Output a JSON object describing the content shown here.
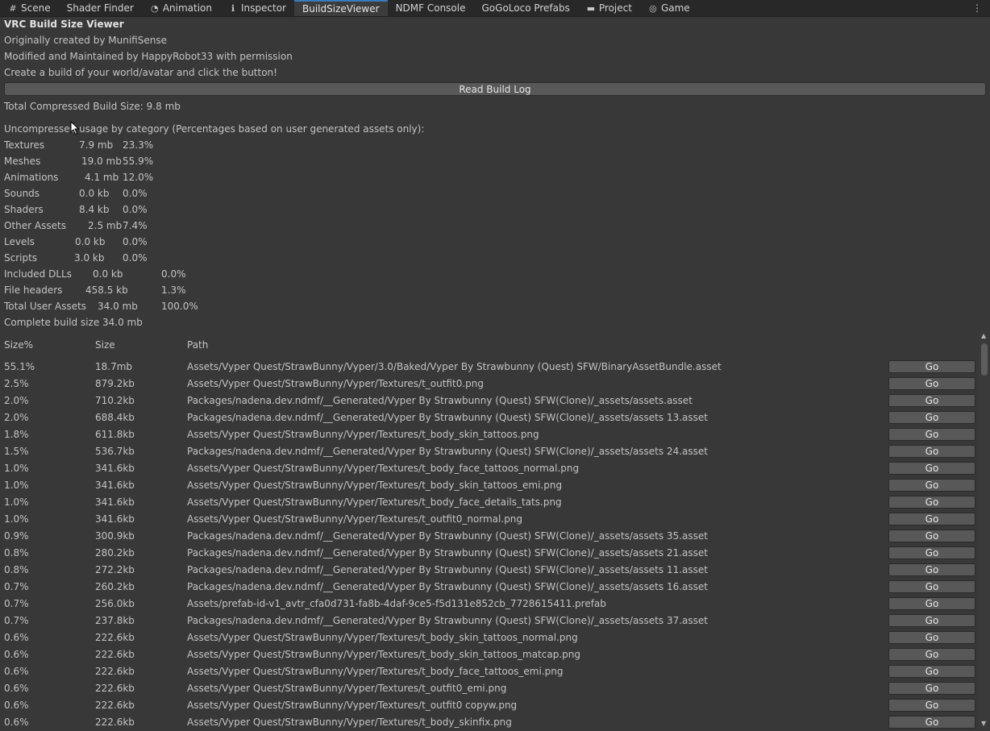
{
  "tabs": [
    {
      "icon": "#",
      "label": "Scene",
      "name": "tab-scene"
    },
    {
      "icon": "",
      "label": "Shader Finder",
      "name": "tab-shader-finder"
    },
    {
      "icon": "◔",
      "label": "Animation",
      "name": "tab-animation"
    },
    {
      "icon": "ℹ",
      "label": "Inspector",
      "name": "tab-inspector"
    },
    {
      "icon": "",
      "label": "BuildSizeViewer",
      "name": "tab-buildsizeviewer",
      "active": true
    },
    {
      "icon": "",
      "label": "NDMF Console",
      "name": "tab-ndmf-console"
    },
    {
      "icon": "",
      "label": "GoGoLoco Prefabs",
      "name": "tab-gogoloco-prefabs"
    },
    {
      "icon": "▬",
      "label": "Project",
      "name": "tab-project"
    },
    {
      "icon": "◎",
      "label": "Game",
      "name": "tab-game"
    }
  ],
  "header": {
    "title": "VRC Build Size Viewer",
    "created_by": "Originally created by MunifiSense",
    "maintained_by": "Modified and Maintained by HappyRobot33 with permission",
    "instruction": "Create a build of your world/avatar and click the button!",
    "read_button": "Read Build Log",
    "total_compressed": "Total Compressed Build Size: 9.8 mb",
    "usage_heading": "Uncompressed usage by category (Percentages based on user generated assets only):"
  },
  "categories": [
    {
      "name": "Textures",
      "size": "7.9 mb",
      "pct": "23.3%"
    },
    {
      "name": "Meshes",
      "size": "19.0 mb",
      "pct": "55.9%"
    },
    {
      "name": "Animations",
      "size": "4.1 mb",
      "pct": "12.0%"
    },
    {
      "name": "Sounds",
      "size": "0.0 kb",
      "pct": "0.0%"
    },
    {
      "name": "Shaders",
      "size": "8.4 kb",
      "pct": "0.0%"
    },
    {
      "name": "Other Assets",
      "size": "2.5 mb",
      "pct": "7.4%"
    },
    {
      "name": "Levels",
      "size": "0.0 kb",
      "pct": "0.0%"
    },
    {
      "name": "Scripts",
      "size": "3.0 kb",
      "pct": "0.0%"
    },
    {
      "name": "Included DLLs",
      "size": "0.0 kb",
      "pct": "0.0%"
    },
    {
      "name": "File headers",
      "size": "458.5 kb",
      "pct": "1.3%"
    },
    {
      "name": "Total User Assets",
      "size": "34.0 mb",
      "pct": "100.0%"
    },
    {
      "name": "Complete build size",
      "size": "34.0 mb",
      "pct": ""
    }
  ],
  "columns": {
    "size_pct": "Size%",
    "size": "Size",
    "path": "Path"
  },
  "go_label": "Go",
  "assets": [
    {
      "pct": "55.1%",
      "size": "18.7mb",
      "path": "Assets/Vyper Quest/StrawBunny/Vyper/3.0/Baked/Vyper By Strawbunny (Quest) SFW/BinaryAssetBundle.asset"
    },
    {
      "pct": "2.5%",
      "size": "879.2kb",
      "path": "Assets/Vyper Quest/StrawBunny/Vyper/Textures/t_outfit0.png"
    },
    {
      "pct": "2.0%",
      "size": "710.2kb",
      "path": "Packages/nadena.dev.ndmf/__Generated/Vyper By Strawbunny (Quest) SFW(Clone)/_assets/assets.asset"
    },
    {
      "pct": "2.0%",
      "size": "688.4kb",
      "path": "Packages/nadena.dev.ndmf/__Generated/Vyper By Strawbunny (Quest) SFW(Clone)/_assets/assets 13.asset"
    },
    {
      "pct": "1.8%",
      "size": "611.8kb",
      "path": "Assets/Vyper Quest/StrawBunny/Vyper/Textures/t_body_skin_tattoos.png"
    },
    {
      "pct": "1.5%",
      "size": "536.7kb",
      "path": "Packages/nadena.dev.ndmf/__Generated/Vyper By Strawbunny (Quest) SFW(Clone)/_assets/assets 24.asset"
    },
    {
      "pct": "1.0%",
      "size": "341.6kb",
      "path": "Assets/Vyper Quest/StrawBunny/Vyper/Textures/t_body_face_tattoos_normal.png"
    },
    {
      "pct": "1.0%",
      "size": "341.6kb",
      "path": "Assets/Vyper Quest/StrawBunny/Vyper/Textures/t_body_skin_tattoos_emi.png"
    },
    {
      "pct": "1.0%",
      "size": "341.6kb",
      "path": "Assets/Vyper Quest/StrawBunny/Vyper/Textures/t_body_face_details_tats.png"
    },
    {
      "pct": "1.0%",
      "size": "341.6kb",
      "path": "Assets/Vyper Quest/StrawBunny/Vyper/Textures/t_outfit0_normal.png"
    },
    {
      "pct": "0.9%",
      "size": "300.9kb",
      "path": "Packages/nadena.dev.ndmf/__Generated/Vyper By Strawbunny (Quest) SFW(Clone)/_assets/assets 35.asset"
    },
    {
      "pct": "0.8%",
      "size": "280.2kb",
      "path": "Packages/nadena.dev.ndmf/__Generated/Vyper By Strawbunny (Quest) SFW(Clone)/_assets/assets 21.asset"
    },
    {
      "pct": "0.8%",
      "size": "272.2kb",
      "path": "Packages/nadena.dev.ndmf/__Generated/Vyper By Strawbunny (Quest) SFW(Clone)/_assets/assets 11.asset"
    },
    {
      "pct": "0.7%",
      "size": "260.2kb",
      "path": "Packages/nadena.dev.ndmf/__Generated/Vyper By Strawbunny (Quest) SFW(Clone)/_assets/assets 16.asset"
    },
    {
      "pct": "0.7%",
      "size": "256.0kb",
      "path": "Assets/prefab-id-v1_avtr_cfa0d731-fa8b-4daf-9ce5-f5d131e852cb_7728615411.prefab"
    },
    {
      "pct": "0.7%",
      "size": "237.8kb",
      "path": "Packages/nadena.dev.ndmf/__Generated/Vyper By Strawbunny (Quest) SFW(Clone)/_assets/assets 37.asset"
    },
    {
      "pct": "0.6%",
      "size": "222.6kb",
      "path": "Assets/Vyper Quest/StrawBunny/Vyper/Textures/t_body_skin_tattoos_normal.png"
    },
    {
      "pct": "0.6%",
      "size": "222.6kb",
      "path": "Assets/Vyper Quest/StrawBunny/Vyper/Textures/t_body_skin_tattoos_matcap.png"
    },
    {
      "pct": "0.6%",
      "size": "222.6kb",
      "path": "Assets/Vyper Quest/StrawBunny/Vyper/Textures/t_body_face_tattoos_emi.png"
    },
    {
      "pct": "0.6%",
      "size": "222.6kb",
      "path": "Assets/Vyper Quest/StrawBunny/Vyper/Textures/t_outfit0_emi.png"
    },
    {
      "pct": "0.6%",
      "size": "222.6kb",
      "path": "Assets/Vyper Quest/StrawBunny/Vyper/Textures/t_outfit0 copyw.png"
    },
    {
      "pct": "0.6%",
      "size": "222.6kb",
      "path": "Assets/Vyper Quest/StrawBunny/Vyper/Textures/t_body_skinfix.png"
    }
  ]
}
